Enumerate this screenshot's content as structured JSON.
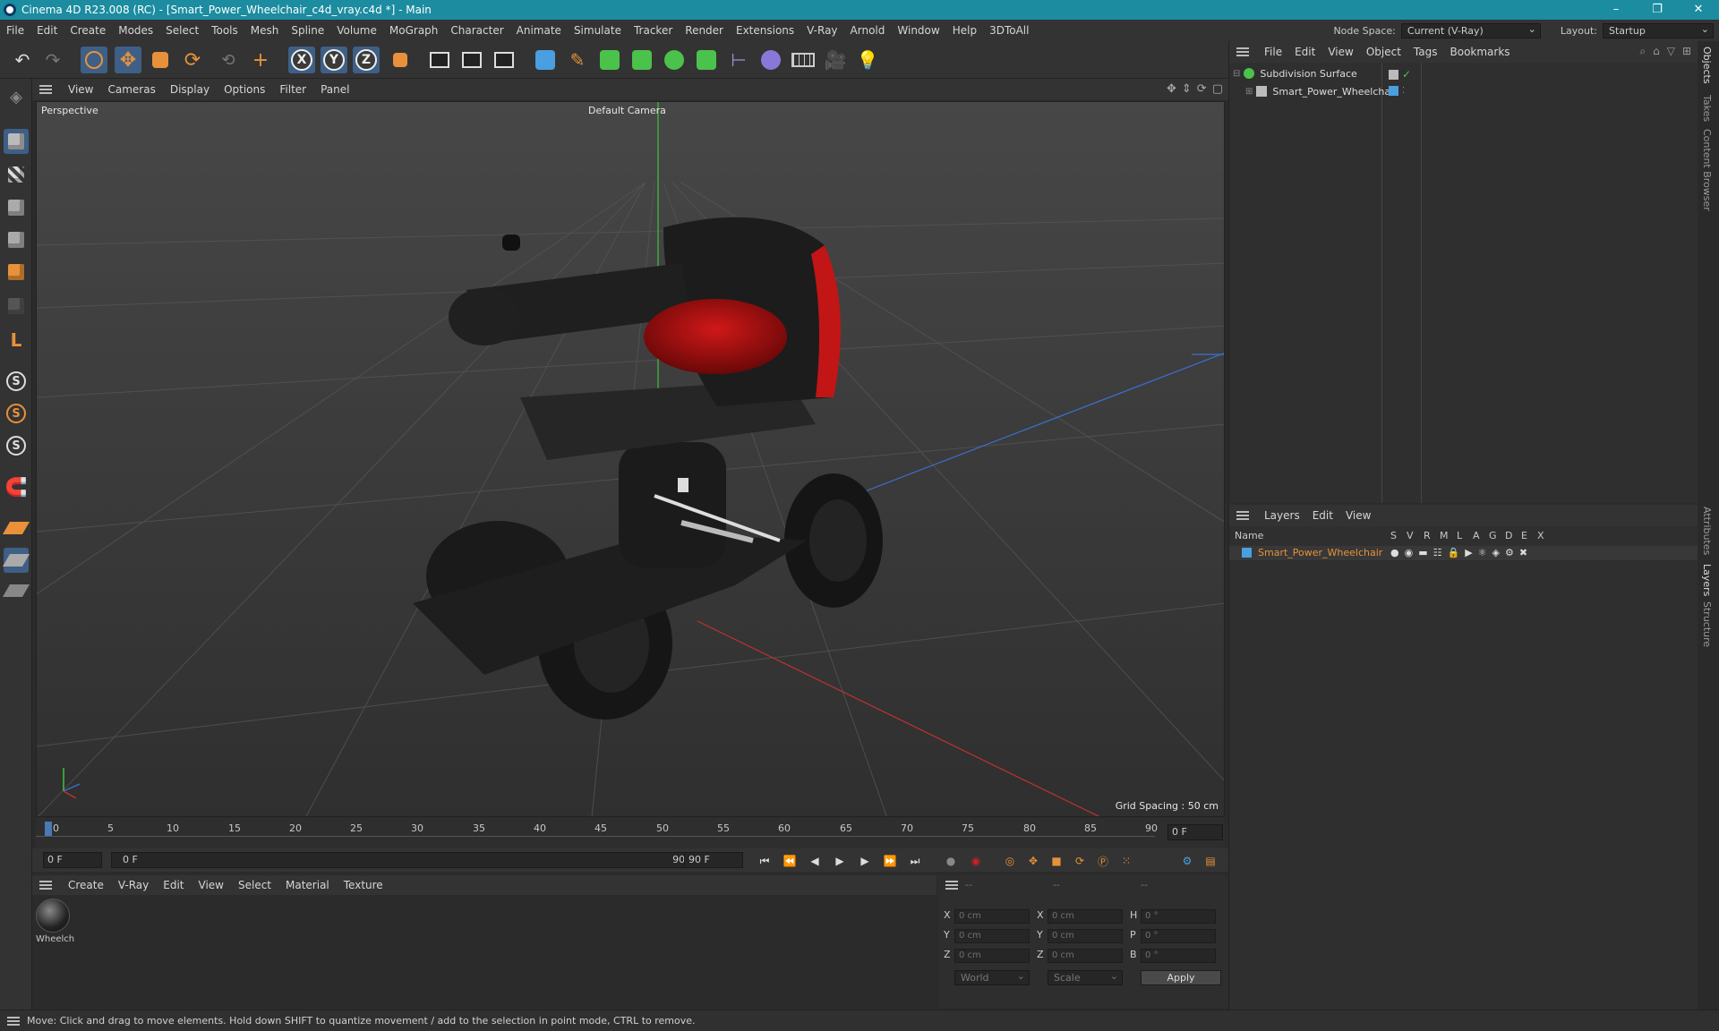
{
  "titlebar": {
    "title": "Cinema 4D R23.008 (RC) - [Smart_Power_Wheelchair_c4d_vray.c4d *] - Main",
    "minimize": "–",
    "restore": "❐",
    "close": "✕"
  },
  "menubar": {
    "items": [
      "File",
      "Edit",
      "Create",
      "Modes",
      "Select",
      "Tools",
      "Mesh",
      "Spline",
      "Volume",
      "MoGraph",
      "Character",
      "Animate",
      "Simulate",
      "Tracker",
      "Render",
      "Extensions",
      "V-Ray",
      "Arnold",
      "Window",
      "Help",
      "3DToAll"
    ],
    "node_space_label": "Node Space:",
    "node_space_value": "Current (V-Ray)",
    "layout_label": "Layout:",
    "layout_value": "Startup"
  },
  "toolbar": {
    "axis_x": "X",
    "axis_y": "Y",
    "axis_z": "Z"
  },
  "lefttools": {
    "s1": "S",
    "s2": "S",
    "s3": "S"
  },
  "viewport": {
    "menu": [
      "View",
      "Cameras",
      "Display",
      "Options",
      "Filter",
      "Panel"
    ],
    "label": "Perspective",
    "camera": "Default Camera",
    "grid_spacing": "Grid Spacing : 50 cm"
  },
  "timeline": {
    "ticks": [
      "0",
      "5",
      "10",
      "15",
      "20",
      "25",
      "30",
      "35",
      "40",
      "45",
      "50",
      "55",
      "60",
      "65",
      "70",
      "75",
      "80",
      "85",
      "90"
    ],
    "current_frame": "0 F"
  },
  "playbar": {
    "start": "0 F",
    "range_start": "0 F",
    "range_end": "90 F",
    "end": "90 F"
  },
  "material_manager": {
    "menu": [
      "Create",
      "V-Ray",
      "Edit",
      "View",
      "Select",
      "Material",
      "Texture"
    ],
    "material_name": "Wheelch"
  },
  "coordinates": {
    "header": [
      "--",
      "--",
      "--"
    ],
    "x_label": "X",
    "y_label": "Y",
    "z_label": "Z",
    "x2_label": "X",
    "y2_label": "Y",
    "z2_label": "Z",
    "h_label": "H",
    "p_label": "P",
    "b_label": "B",
    "pos_x": "0 cm",
    "pos_y": "0 cm",
    "pos_z": "0 cm",
    "size_x": "0 cm",
    "size_y": "0 cm",
    "size_z": "0 cm",
    "rot_h": "0 °",
    "rot_p": "0 °",
    "rot_b": "0 °",
    "mode": "World",
    "transform": "Scale",
    "apply": "Apply"
  },
  "object_manager": {
    "menu": [
      "File",
      "Edit",
      "View",
      "Object",
      "Tags",
      "Bookmarks"
    ],
    "objects": [
      "Subdivision Surface",
      "Smart_Power_Wheelchair"
    ]
  },
  "layer_manager": {
    "menu": [
      "Layers",
      "Edit",
      "View"
    ],
    "col_name": "Name",
    "cols": [
      "S",
      "V",
      "R",
      "M",
      "L",
      "A",
      "G",
      "D",
      "E",
      "X"
    ],
    "layer_name": "Smart_Power_Wheelchair"
  },
  "sidetabs": [
    "Objects",
    "Takes",
    "Content Browser",
    "Attributes",
    "Layers",
    "Structure"
  ],
  "statusbar": {
    "text": "Move: Click and drag to move elements. Hold down SHIFT to quantize movement / add to the selection in point mode, CTRL to remove."
  },
  "colors": {
    "titlebar": "#1c8ca0",
    "selection": "#3e5f86",
    "accent_orange": "#e8913a",
    "layer_text": "#e8913a"
  }
}
